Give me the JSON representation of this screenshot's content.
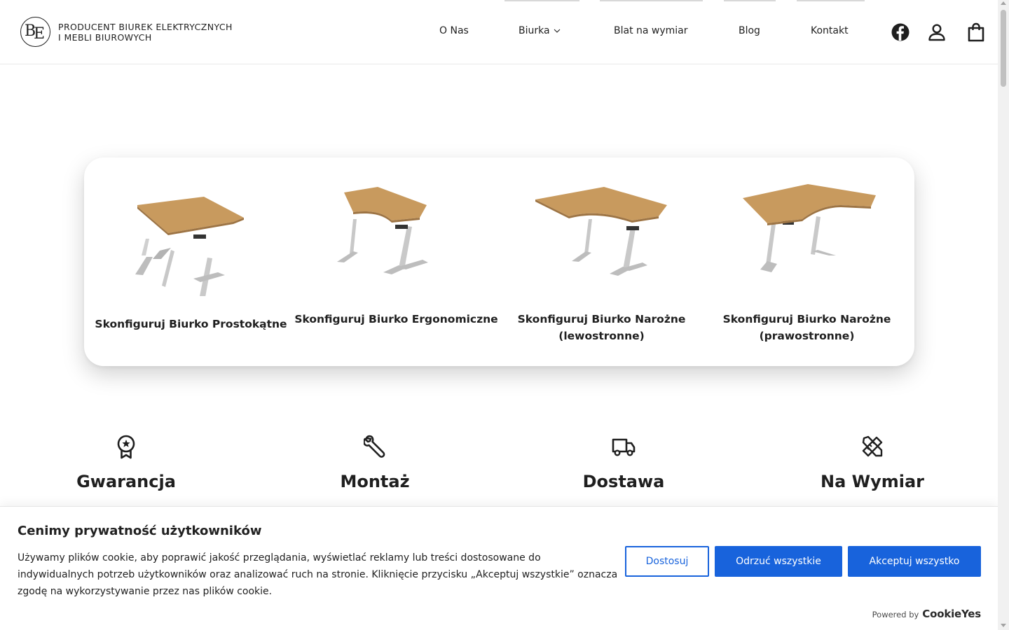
{
  "header": {
    "logo": {
      "mark": "BE",
      "line1": "PRODUCENT BIUREK ELEKTRYCZNYCH",
      "line2": "I MEBLI BIUROWYCH"
    },
    "nav": [
      {
        "label": "O Nas"
      },
      {
        "label": "Biurka",
        "has_dropdown": true
      },
      {
        "label": "Blat na wymiar"
      },
      {
        "label": "Blog"
      },
      {
        "label": "Kontakt"
      }
    ],
    "icons": [
      "facebook-icon",
      "user-icon",
      "shopping-bag-icon"
    ]
  },
  "configurator": {
    "items": [
      {
        "label": "Skonfiguruj Biurko Prostokątne",
        "shape": "rectangular"
      },
      {
        "label": "Skonfiguruj Biurko Ergonomiczne",
        "shape": "ergonomic"
      },
      {
        "label": "Skonfiguruj Biurko Narożne (lewostronne)",
        "shape": "corner-left"
      },
      {
        "label": "Skonfiguruj Biurko Narożne (prawostronne)",
        "shape": "corner-right"
      }
    ]
  },
  "features": [
    {
      "title": "Gwarancja",
      "icon": "award-icon"
    },
    {
      "title": "Montaż",
      "icon": "wrench-icon"
    },
    {
      "title": "Dostawa",
      "icon": "truck-icon"
    },
    {
      "title": "Na Wymiar",
      "icon": "ruler-pencil-icon"
    }
  ],
  "cookie": {
    "title": "Cenimy prywatność użytkowników",
    "text": "Używamy plików cookie, aby poprawić jakość przeglądania, wyświetlać reklamy lub treści dostosowane do indywidualnych potrzeb użytkowników oraz analizować ruch na stronie. Kliknięcie przycisku „Akceptuj wszystkie” oznacza zgodę na wykorzystywanie przez nas plików cookie.",
    "buttons": {
      "customize": "Dostosuj",
      "reject": "Odrzuć wszystkie",
      "accept": "Akceptuj wszystko"
    },
    "powered_by": "Powered by",
    "brand": "CookieYes"
  },
  "colors": {
    "accent": "#1863dc",
    "text": "#1f1f1f",
    "wood": "#c9975b",
    "leg": "#c8c8c8"
  }
}
